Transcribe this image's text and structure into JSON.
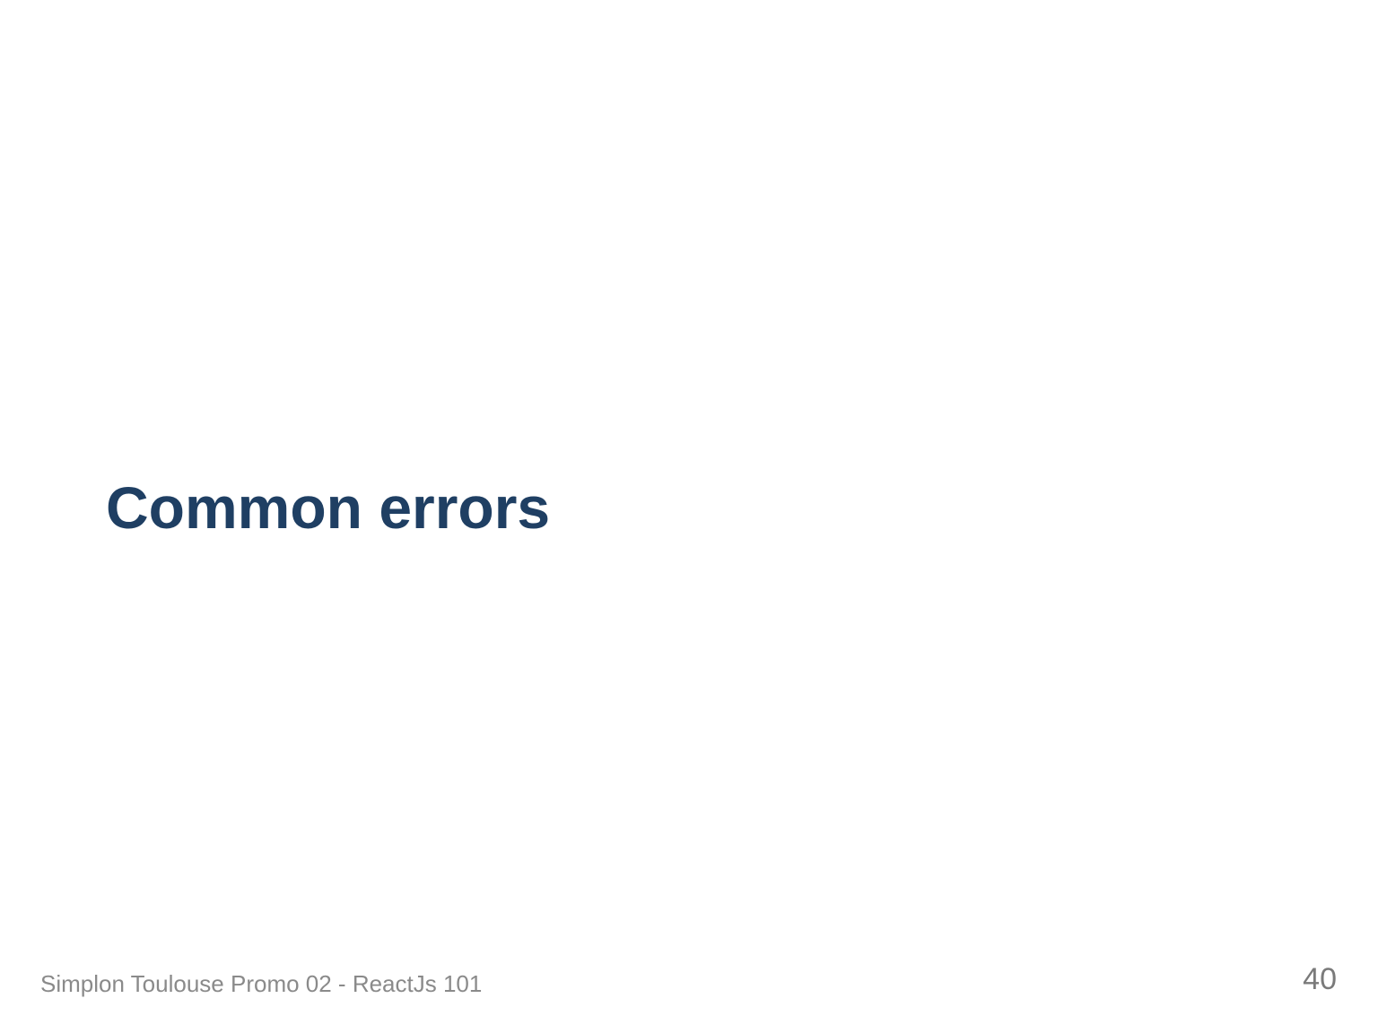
{
  "slide": {
    "title": "Common errors",
    "footer": "Simplon Toulouse Promo 02 - ReactJs 101",
    "page_number": "40"
  },
  "colors": {
    "title": "#1f3f63",
    "footer": "#8a8a8a",
    "page_number": "#7a7a7a",
    "background": "#ffffff"
  }
}
